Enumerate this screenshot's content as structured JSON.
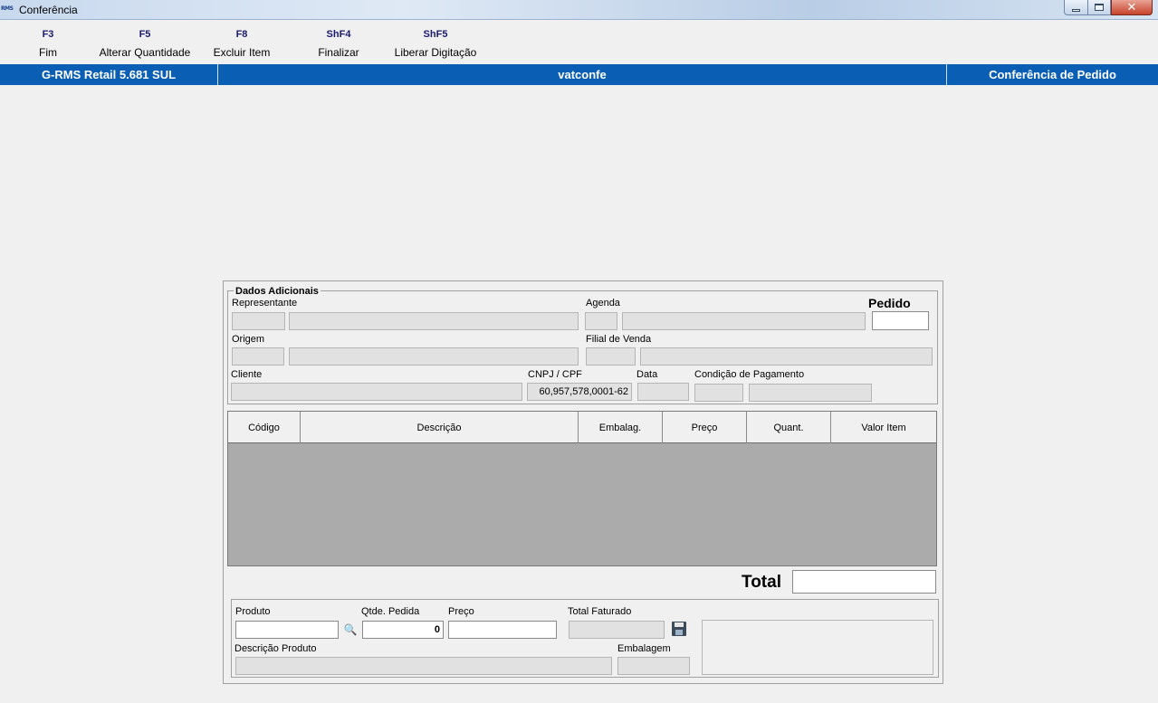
{
  "window": {
    "logo_text": "RMS",
    "title": "Conferência",
    "close_glyph": "✕"
  },
  "toolbar": {
    "keys": [
      {
        "key": "F3",
        "label": "Fim"
      },
      {
        "key": "F5",
        "label": "Alterar Quantidade"
      },
      {
        "key": "F8",
        "label": "Excluir Item"
      },
      {
        "key": "ShF4",
        "label": "Finalizar"
      },
      {
        "key": "ShF5",
        "label": "Liberar Digitação"
      }
    ]
  },
  "statusbar": {
    "app_version": "G-RMS Retail 5.681 SUL",
    "program": "vatconfe",
    "screen": "Conferência de Pedido",
    "color": "#0a5fb4"
  },
  "dados_adicionais": {
    "title": "Dados Adicionais",
    "representante_label": "Representante",
    "agenda_label": "Agenda",
    "pedido_label": "Pedido",
    "pedido_value": "",
    "origem_label": "Origem",
    "filial_label": "Filial de Venda",
    "cliente_label": "Cliente",
    "cnpj_label": "CNPJ / CPF",
    "cnpj_value": "60,957,578,0001-62",
    "data_label": "Data",
    "condicao_label": "Condição de Pagamento"
  },
  "grid": {
    "columns": [
      "Código",
      "Descrição",
      "Embalag.",
      "Preço",
      "Quant.",
      "Valor Item"
    ],
    "rows": []
  },
  "totals": {
    "total_label": "Total",
    "total_value": ""
  },
  "entry": {
    "produto_label": "Produto",
    "produto_value": "",
    "qtde_label": "Qtde. Pedida",
    "qtde_value": "0",
    "preco_label": "Preço",
    "preco_value": "",
    "total_faturado_label": "Total Faturado",
    "descricao_label": "Descrição Produto",
    "embalagem_label": "Embalagem",
    "search_icon": "binoculars-icon",
    "save_icon": "floppy-disk-icon"
  }
}
